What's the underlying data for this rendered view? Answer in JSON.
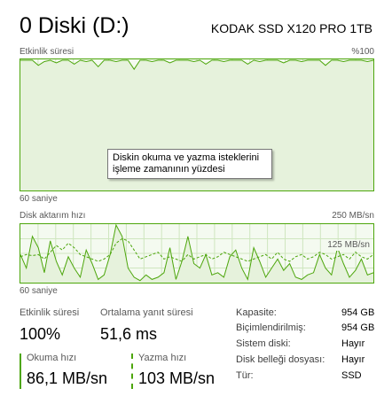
{
  "header": {
    "title": "0 Diski (D:)",
    "model": "KODAK SSD X120 PRO 1TB"
  },
  "active_time_graph": {
    "label": "Etkinlik süresi",
    "max_label": "%100",
    "duration_label": "60 saniye",
    "samples_percent": [
      100,
      100,
      100,
      96,
      99,
      100,
      98,
      100,
      100,
      97,
      100,
      99,
      100,
      95,
      100,
      100,
      99,
      100,
      100,
      93,
      100,
      100,
      99,
      100,
      100,
      98,
      100,
      100,
      100,
      99,
      100,
      97,
      100,
      100,
      99,
      100,
      100,
      100,
      97,
      100,
      99,
      100,
      100,
      100,
      98,
      100,
      100,
      99,
      100,
      100,
      100,
      96,
      100,
      100,
      99,
      100,
      100,
      100,
      99,
      100
    ]
  },
  "transfer_graph": {
    "label": "Disk aktarım hızı",
    "max_label": "250 MB/sn",
    "mid_label": "125 MB/sn",
    "duration_label": "60 saniye",
    "read_mb_s": [
      120,
      60,
      200,
      150,
      40,
      180,
      90,
      30,
      110,
      60,
      20,
      140,
      80,
      10,
      30,
      120,
      250,
      200,
      60,
      20,
      5,
      30,
      10,
      20,
      40,
      150,
      10,
      90,
      200,
      80,
      60,
      120,
      30,
      40,
      20,
      110,
      140,
      60,
      10,
      150,
      90,
      20,
      60,
      100,
      50,
      80,
      20,
      10,
      30,
      40,
      120,
      60,
      30,
      150,
      80,
      20,
      50,
      100,
      30,
      40
    ],
    "write_mb_s": [
      110,
      120,
      115,
      120,
      100,
      130,
      160,
      140,
      170,
      150,
      120,
      110,
      100,
      90,
      100,
      120,
      170,
      190,
      180,
      140,
      100,
      110,
      120,
      130,
      100,
      110,
      100,
      90,
      120,
      100,
      110,
      120,
      100,
      110,
      130,
      120,
      110,
      100,
      90,
      100,
      110,
      120,
      100,
      130,
      100,
      90,
      110,
      120,
      100,
      110,
      130,
      120,
      100,
      110,
      120,
      100,
      130,
      110,
      100,
      120
    ]
  },
  "tooltip": {
    "line1": "Diskin okuma ve yazma isteklerini",
    "line2": "işleme zamanının yüzdesi"
  },
  "stats": {
    "active_time_label": "Etkinlik süresi",
    "active_time_value": "100%",
    "avg_response_label": "Ortalama yanıt süresi",
    "avg_response_value": "51,6 ms",
    "read_speed_label": "Okuma hızı",
    "read_speed_value": "86,1 MB/sn",
    "write_speed_label": "Yazma hızı",
    "write_speed_value": "103 MB/sn"
  },
  "properties": [
    {
      "label": "Kapasite:",
      "value": "954 GB"
    },
    {
      "label": "Biçimlendirilmiş:",
      "value": "954 GB"
    },
    {
      "label": "Sistem diski:",
      "value": "Hayır"
    },
    {
      "label": "Disk belleği dosyası:",
      "value": "Hayır"
    },
    {
      "label": "Tür:",
      "value": "SSD"
    }
  ],
  "colors": {
    "accent": "#4da60c",
    "graph_bg": "#f4faf0",
    "grid": "#cfe6bf"
  }
}
